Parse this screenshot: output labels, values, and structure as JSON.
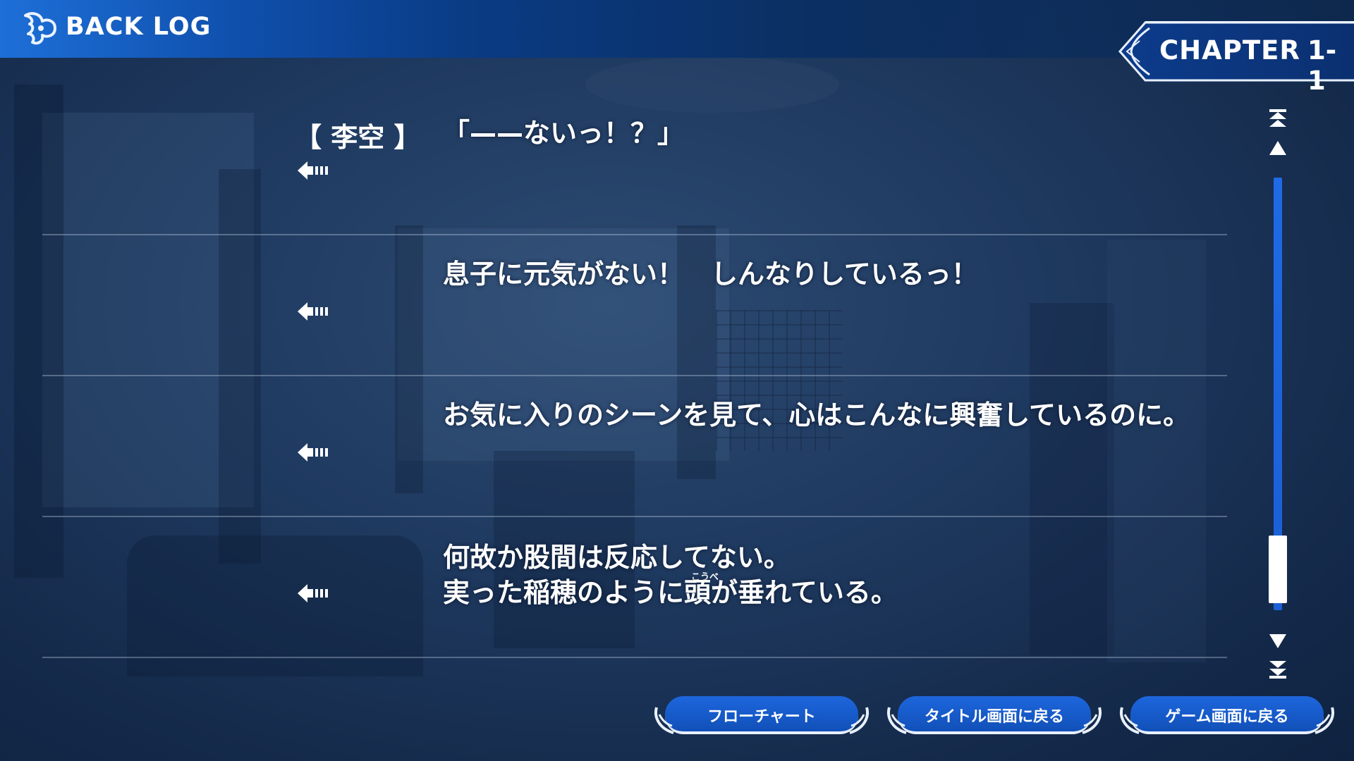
{
  "header": {
    "title": "BACK LOG"
  },
  "chapter": {
    "label": "CHAPTER",
    "number": "1-1"
  },
  "entries": [
    {
      "speaker": "【 李空 】",
      "lines": [
        "「——ないっ！？」"
      ]
    },
    {
      "speaker": "",
      "lines": [
        "息子に元気がない！　しんなりしているっ！"
      ]
    },
    {
      "speaker": "",
      "lines": [
        "お気に入りのシーンを見て、心はこんなに興奮しているのに。"
      ]
    },
    {
      "speaker": "",
      "lines": [
        "何故か股間は反応してない。",
        "実った稲穂のように頭が垂れている。"
      ],
      "ruby": "こうべ"
    }
  ],
  "scroll": {
    "position": 0.9
  },
  "buttons": {
    "flowchart": "フローチャート",
    "title_screen": "タイトル画面に戻る",
    "game_screen": "ゲーム画面に戻る"
  },
  "colors": {
    "accent": "#1d66dd",
    "header": "#0f4fab",
    "text": "#ffffff"
  },
  "icons": {
    "header": "wing-icon",
    "voice": "voice-replay-arrow-icon",
    "scroll_top": "scroll-top-icon",
    "scroll_up": "scroll-up-icon",
    "scroll_down": "scroll-down-icon",
    "scroll_bottom": "scroll-bottom-icon"
  }
}
